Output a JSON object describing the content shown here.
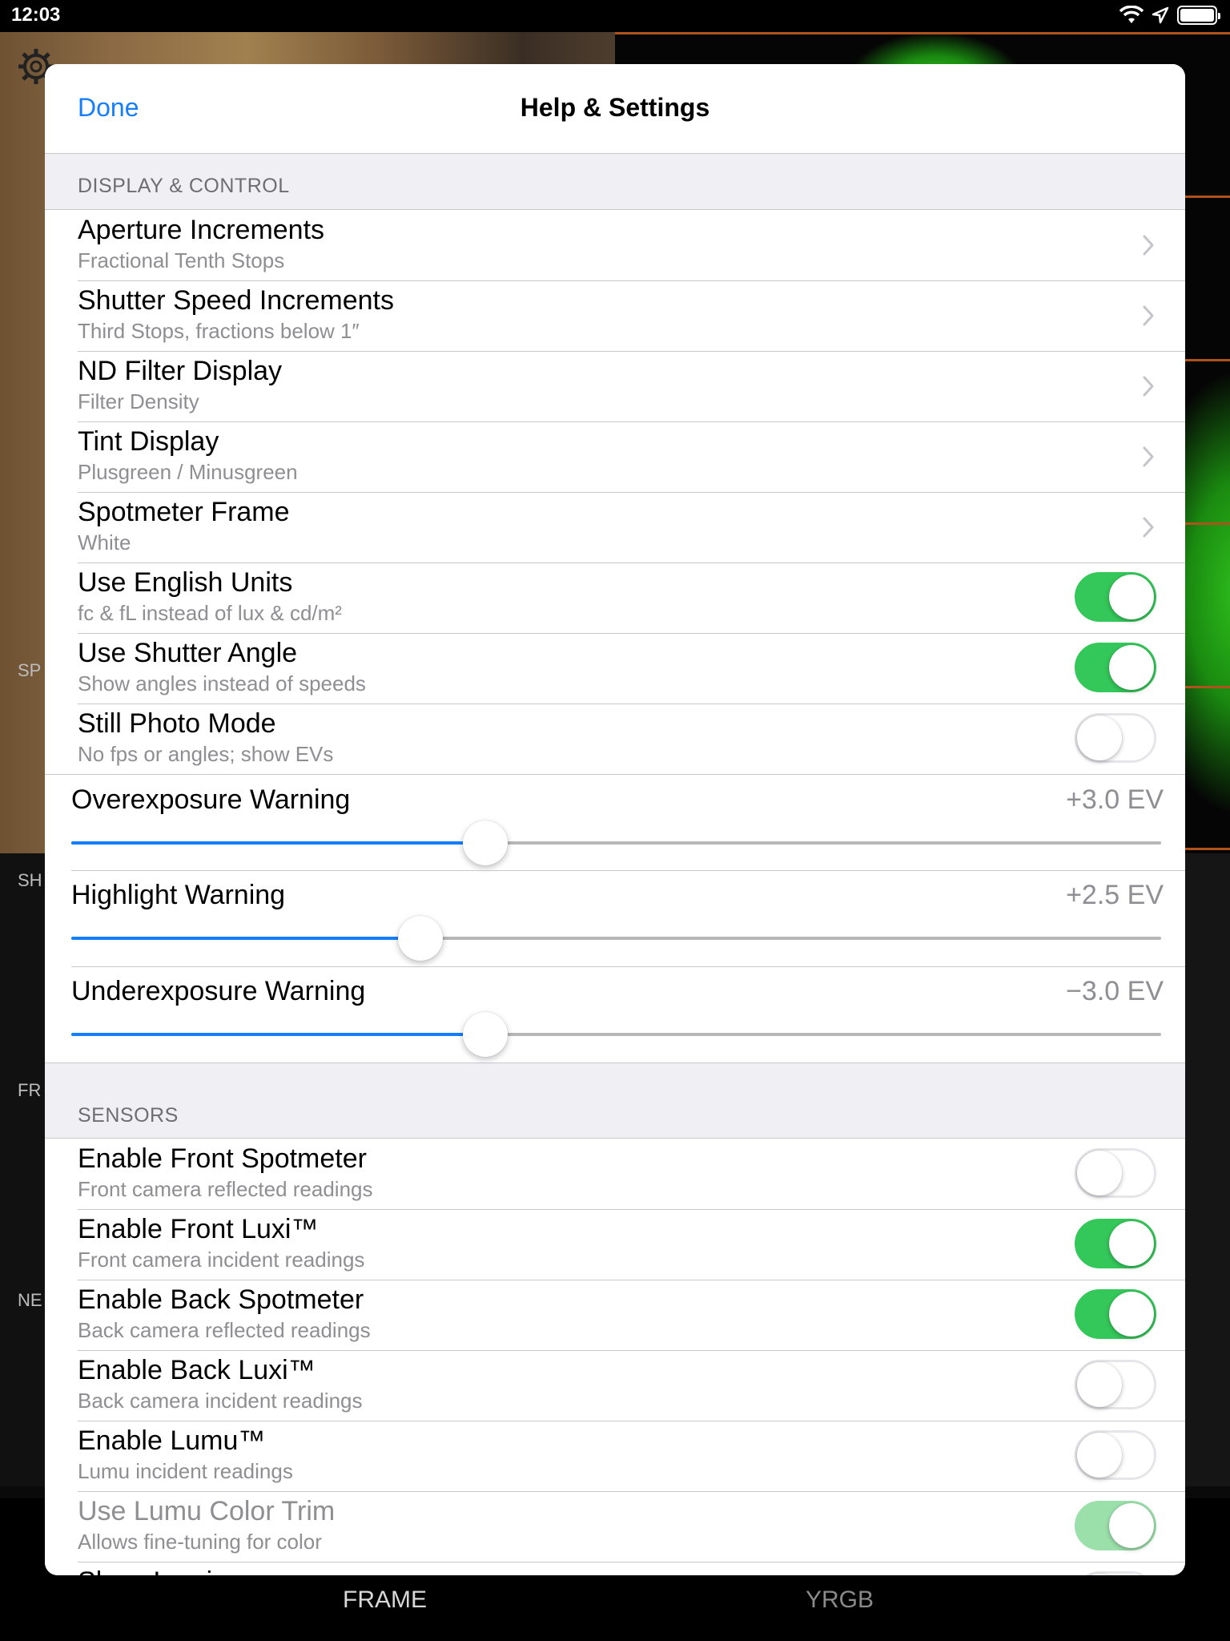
{
  "status_bar": {
    "time": "12:03"
  },
  "background": {
    "labels": [
      "SP",
      "SH",
      "FR",
      "NE"
    ],
    "tabs": [
      "FRAME",
      "YRGB"
    ]
  },
  "modal": {
    "done_label": "Done",
    "title": "Help & Settings",
    "sections": [
      {
        "header": "DISPLAY & CONTROL",
        "rows": [
          {
            "title": "Aperture Increments",
            "subtitle": "Fractional Tenth Stops",
            "kind": "disclosure"
          },
          {
            "title": "Shutter Speed Increments",
            "subtitle": "Third Stops, fractions below 1″",
            "kind": "disclosure"
          },
          {
            "title": "ND Filter Display",
            "subtitle": "Filter Density",
            "kind": "disclosure"
          },
          {
            "title": "Tint Display",
            "subtitle": "Plusgreen / Minusgreen",
            "kind": "disclosure"
          },
          {
            "title": "Spotmeter Frame",
            "subtitle": "White",
            "kind": "disclosure"
          },
          {
            "title": "Use English Units",
            "subtitle": "fc & fL instead of lux & cd/m²",
            "kind": "switch",
            "on": true
          },
          {
            "title": "Use Shutter Angle",
            "subtitle": "Show angles instead of speeds",
            "kind": "switch",
            "on": true
          },
          {
            "title": "Still Photo Mode",
            "subtitle": "No fps or angles; show EVs",
            "kind": "switch",
            "on": false
          }
        ],
        "sliders": [
          {
            "title": "Overexposure Warning",
            "value": "+3.0 EV",
            "fraction": 0.38
          },
          {
            "title": "Highlight Warning",
            "value": "+2.5 EV",
            "fraction": 0.32
          },
          {
            "title": "Underexposure Warning",
            "value": "−3.0 EV",
            "fraction": 0.38
          }
        ]
      },
      {
        "header": "SENSORS",
        "rows": [
          {
            "title": "Enable Front Spotmeter",
            "subtitle": "Front camera reflected readings",
            "kind": "switch",
            "on": false
          },
          {
            "title": "Enable Front Luxi™",
            "subtitle": "Front camera incident readings",
            "kind": "switch",
            "on": true
          },
          {
            "title": "Enable Back Spotmeter",
            "subtitle": "Back camera reflected readings",
            "kind": "switch",
            "on": true
          },
          {
            "title": "Enable Back Luxi™",
            "subtitle": "Back camera incident readings",
            "kind": "switch",
            "on": false
          },
          {
            "title": "Enable Lumu™",
            "subtitle": "Lumu incident readings",
            "kind": "switch",
            "on": false
          },
          {
            "title": "Use Lumu Color Trim",
            "subtitle": "Allows fine-tuning for color",
            "kind": "switch",
            "on": true,
            "disabled": true
          },
          {
            "title": "Show Luminance",
            "subtitle": "",
            "kind": "switch",
            "on": false
          }
        ]
      }
    ]
  }
}
